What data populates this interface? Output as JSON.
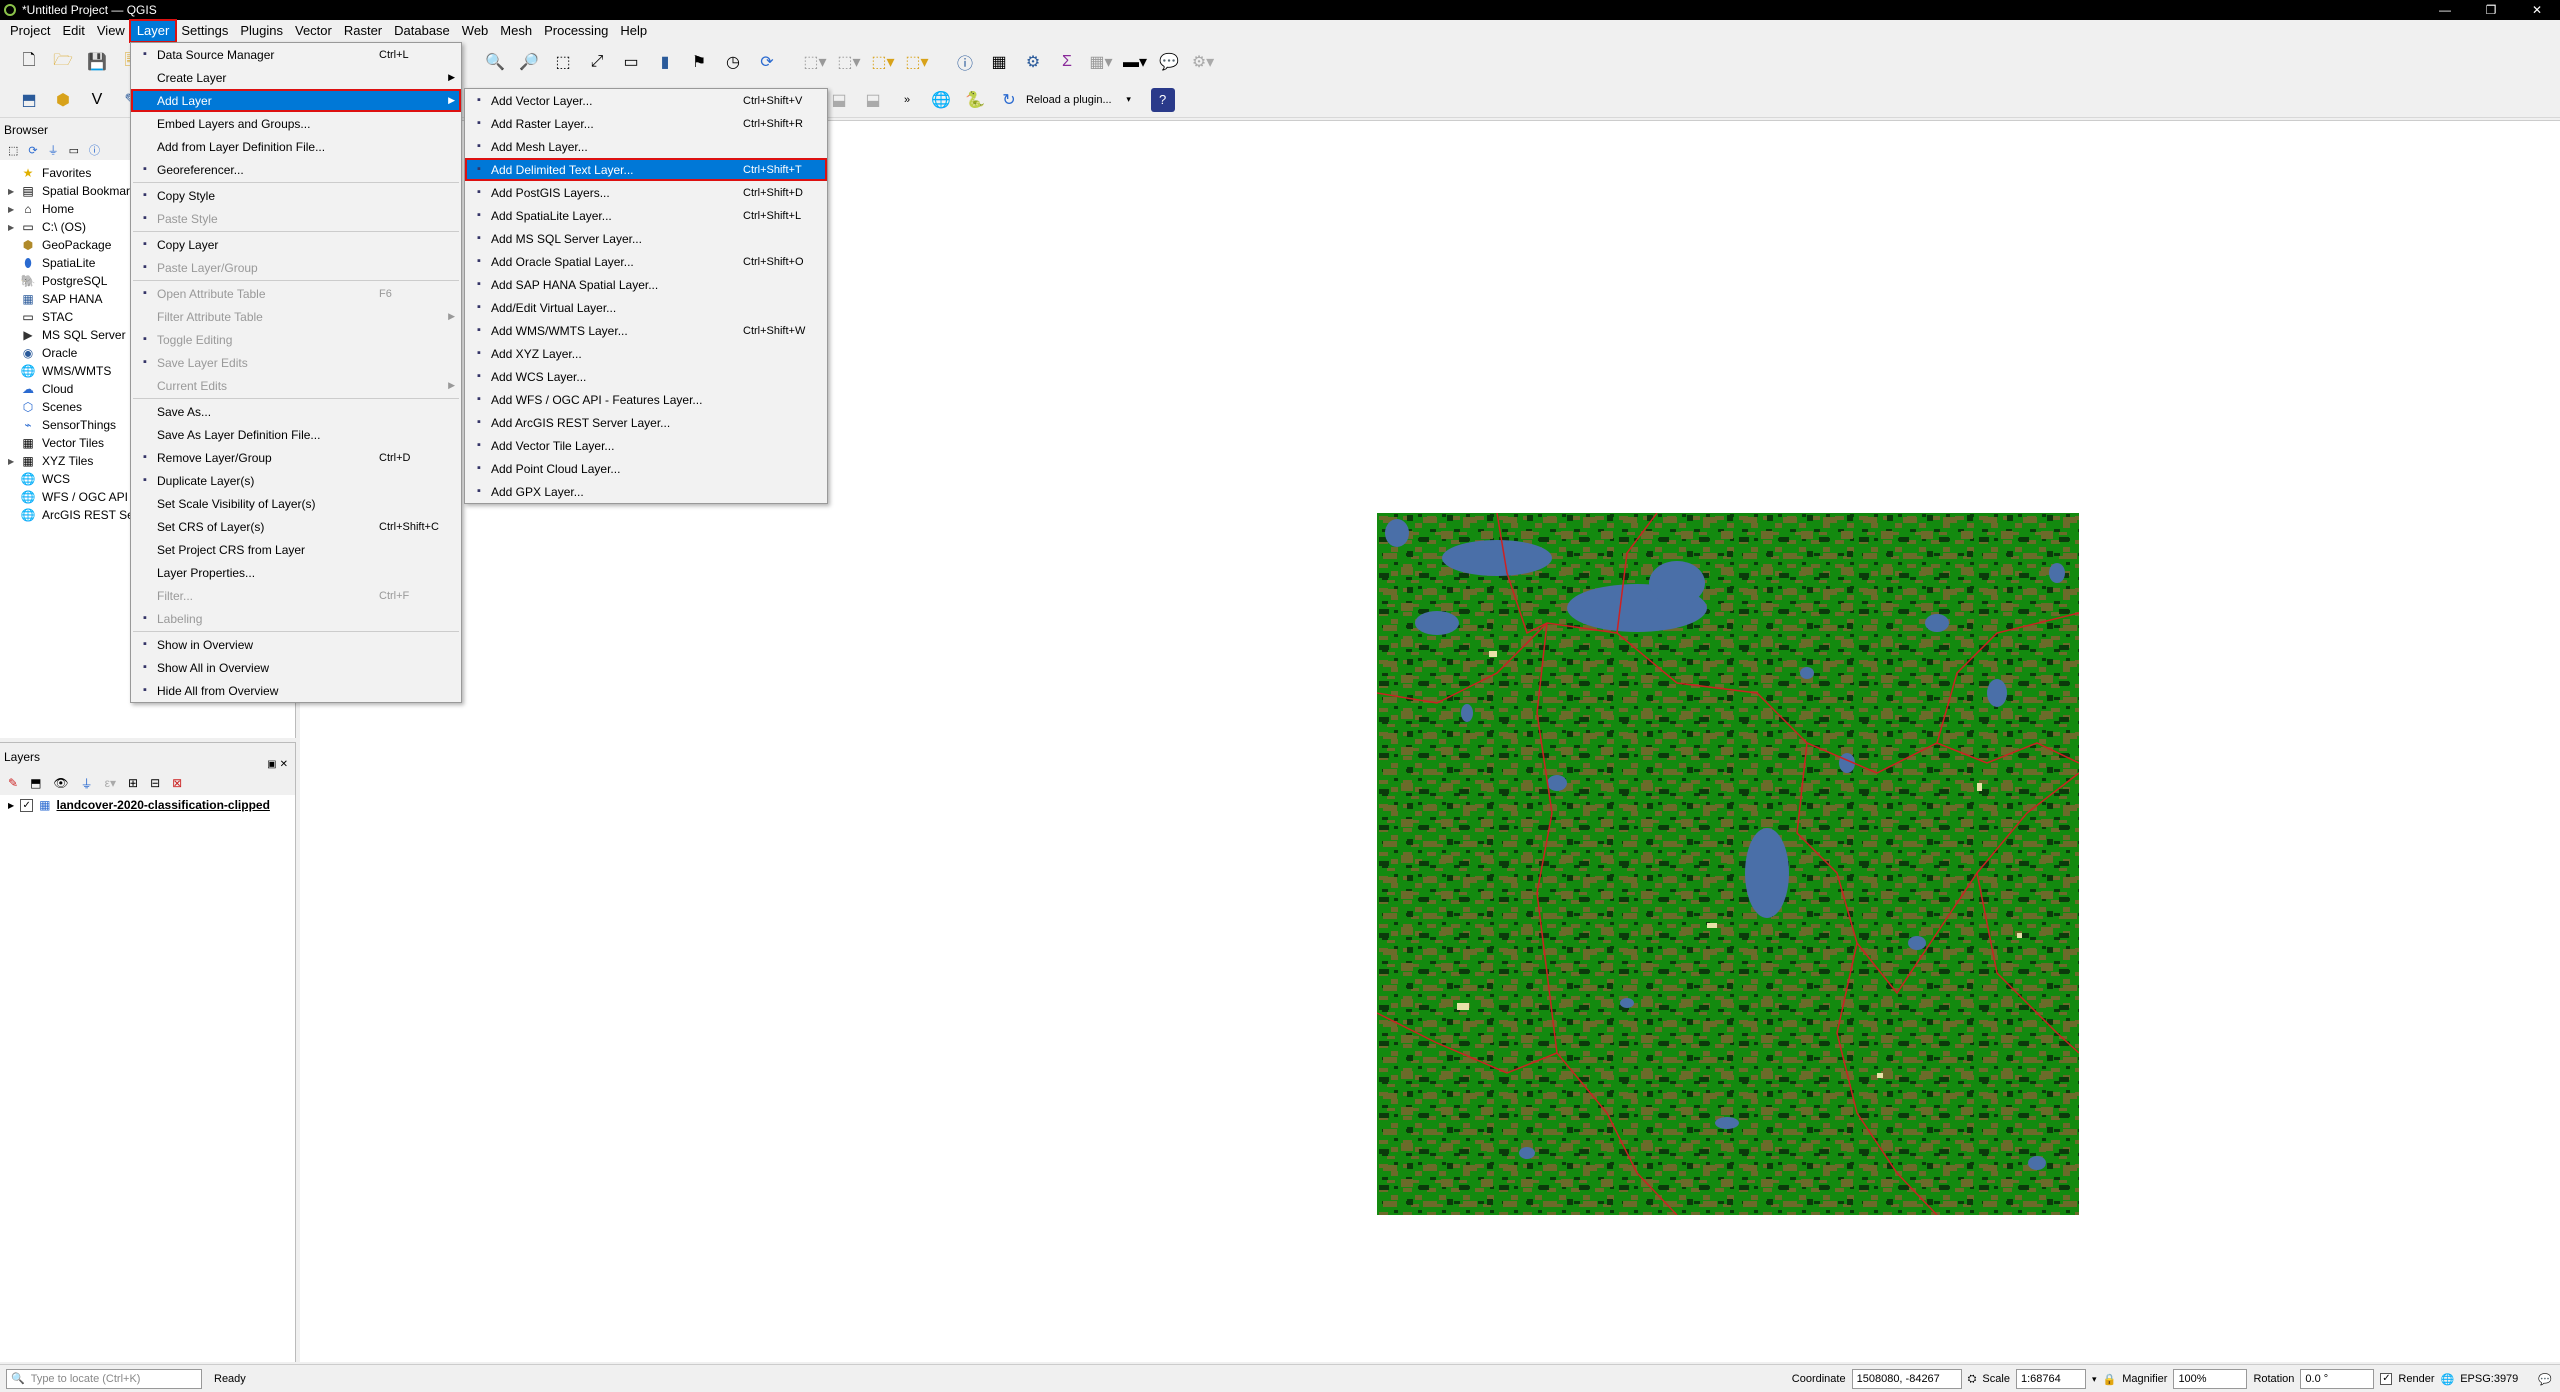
{
  "window": {
    "title": "*Untitled Project — QGIS",
    "controls": [
      "—",
      "❐",
      "✕"
    ]
  },
  "menubar": [
    "Project",
    "Edit",
    "View",
    "Layer",
    "Settings",
    "Plugins",
    "Vector",
    "Raster",
    "Database",
    "Web",
    "Mesh",
    "Processing",
    "Help"
  ],
  "toolbar2": {
    "reload_plugin": "Reload a plugin..."
  },
  "browser": {
    "title": "Browser",
    "items": [
      {
        "label": "Favorites",
        "icon": "star-icon",
        "expand": false
      },
      {
        "label": "Spatial Bookmarks",
        "icon": "bookmark-icon",
        "expand": true
      },
      {
        "label": "Home",
        "icon": "home-icon",
        "expand": true
      },
      {
        "label": "C:\\ (OS)",
        "icon": "drive-icon",
        "expand": true
      },
      {
        "label": "GeoPackage",
        "icon": "geopackage-icon",
        "expand": false
      },
      {
        "label": "SpatiaLite",
        "icon": "spatialite-icon",
        "expand": false
      },
      {
        "label": "PostgreSQL",
        "icon": "postgresql-icon",
        "expand": false
      },
      {
        "label": "SAP HANA",
        "icon": "sap-hana-icon",
        "expand": false
      },
      {
        "label": "STAC",
        "icon": "stac-icon",
        "expand": false
      },
      {
        "label": "MS SQL Server",
        "icon": "mssql-icon",
        "expand": false
      },
      {
        "label": "Oracle",
        "icon": "oracle-icon",
        "expand": false
      },
      {
        "label": "WMS/WMTS",
        "icon": "wms-icon",
        "expand": false
      },
      {
        "label": "Cloud",
        "icon": "cloud-icon",
        "expand": false
      },
      {
        "label": "Scenes",
        "icon": "scenes-icon",
        "expand": false
      },
      {
        "label": "SensorThings",
        "icon": "sensorthings-icon",
        "expand": false
      },
      {
        "label": "Vector Tiles",
        "icon": "vector-tiles-icon",
        "expand": false
      },
      {
        "label": "XYZ Tiles",
        "icon": "xyz-tiles-icon",
        "expand": true
      },
      {
        "label": "WCS",
        "icon": "wcs-icon",
        "expand": false
      },
      {
        "label": "WFS / OGC API - Features",
        "icon": "wfs-icon",
        "expand": false
      },
      {
        "label": "ArcGIS REST Servers",
        "icon": "arcgis-icon",
        "expand": false
      }
    ]
  },
  "layers": {
    "title": "Layers",
    "items": [
      {
        "label": "landcover-2020-classification-clipped",
        "checked": true
      }
    ]
  },
  "layer_menu": [
    {
      "label": "Data Source Manager",
      "shortcut": "Ctrl+L",
      "icon": "data-source-manager-icon"
    },
    {
      "label": "Create Layer",
      "submenu": true
    },
    {
      "label": "Add Layer",
      "submenu": true,
      "highlighted": true
    },
    {
      "label": "Embed Layers and Groups..."
    },
    {
      "label": "Add from Layer Definition File..."
    },
    {
      "label": "Georeferencer...",
      "icon": "georeferencer-icon"
    },
    {
      "sep": true
    },
    {
      "label": "Copy Style",
      "icon": "copy-style-icon"
    },
    {
      "label": "Paste Style",
      "icon": "paste-style-icon",
      "disabled": true
    },
    {
      "sep": true
    },
    {
      "label": "Copy Layer",
      "icon": "copy-layer-icon"
    },
    {
      "label": "Paste Layer/Group",
      "icon": "paste-layer-icon",
      "disabled": true
    },
    {
      "sep": true
    },
    {
      "label": "Open Attribute Table",
      "shortcut": "F6",
      "icon": "attribute-table-icon",
      "disabled": true
    },
    {
      "label": "Filter Attribute Table",
      "submenu": true,
      "disabled": true
    },
    {
      "label": "Toggle Editing",
      "icon": "pencil-icon",
      "disabled": true
    },
    {
      "label": "Save Layer Edits",
      "icon": "save-edits-icon",
      "disabled": true
    },
    {
      "label": "Current Edits",
      "submenu": true,
      "disabled": true
    },
    {
      "sep": true
    },
    {
      "label": "Save As..."
    },
    {
      "label": "Save As Layer Definition File..."
    },
    {
      "label": "Remove Layer/Group",
      "shortcut": "Ctrl+D",
      "icon": "remove-layer-icon"
    },
    {
      "label": "Duplicate Layer(s)",
      "icon": "duplicate-layer-icon"
    },
    {
      "label": "Set Scale Visibility of Layer(s)"
    },
    {
      "label": "Set CRS of Layer(s)",
      "shortcut": "Ctrl+Shift+C"
    },
    {
      "label": "Set Project CRS from Layer"
    },
    {
      "label": "Layer Properties..."
    },
    {
      "label": "Filter...",
      "shortcut": "Ctrl+F",
      "disabled": true
    },
    {
      "label": "Labeling",
      "icon": "labeling-icon",
      "disabled": true
    },
    {
      "sep": true
    },
    {
      "label": "Show in Overview",
      "icon": "overview-icon"
    },
    {
      "label": "Show All in Overview",
      "icon": "overview-icon"
    },
    {
      "label": "Hide All from Overview",
      "icon": "overview-icon"
    }
  ],
  "add_layer_menu": [
    {
      "label": "Add Vector Layer...",
      "shortcut": "Ctrl+Shift+V",
      "icon": "vector-layer-icon"
    },
    {
      "label": "Add Raster Layer...",
      "shortcut": "Ctrl+Shift+R",
      "icon": "raster-layer-icon"
    },
    {
      "label": "Add Mesh Layer...",
      "icon": "mesh-layer-icon"
    },
    {
      "label": "Add Delimited Text Layer...",
      "shortcut": "Ctrl+Shift+T",
      "icon": "delimited-text-icon",
      "highlighted": true
    },
    {
      "label": "Add PostGIS Layers...",
      "shortcut": "Ctrl+Shift+D",
      "icon": "postgis-icon"
    },
    {
      "label": "Add SpatiaLite Layer...",
      "shortcut": "Ctrl+Shift+L",
      "icon": "spatialite-icon"
    },
    {
      "label": "Add MS SQL Server Layer...",
      "icon": "mssql-icon"
    },
    {
      "label": "Add Oracle Spatial Layer...",
      "shortcut": "Ctrl+Shift+O",
      "icon": "oracle-icon"
    },
    {
      "label": "Add SAP HANA Spatial Layer...",
      "icon": "sap-hana-icon"
    },
    {
      "label": "Add/Edit Virtual Layer...",
      "icon": "virtual-layer-icon"
    },
    {
      "label": "Add WMS/WMTS Layer...",
      "shortcut": "Ctrl+Shift+W",
      "icon": "wms-icon"
    },
    {
      "label": "Add XYZ Layer...",
      "icon": "xyz-icon"
    },
    {
      "label": "Add WCS Layer...",
      "icon": "wcs-icon"
    },
    {
      "label": "Add WFS / OGC API - Features Layer...",
      "icon": "wfs-icon"
    },
    {
      "label": "Add ArcGIS REST Server Layer...",
      "icon": "arcgis-icon"
    },
    {
      "label": "Add Vector Tile Layer...",
      "icon": "vector-tile-icon"
    },
    {
      "label": "Add Point Cloud Layer...",
      "icon": "point-cloud-icon"
    },
    {
      "label": "Add GPX Layer...",
      "icon": "gpx-icon"
    }
  ],
  "statusbar": {
    "locator_placeholder": "Type to locate (Ctrl+K)",
    "ready": "Ready",
    "coordinate_label": "Coordinate",
    "coordinate_value": "1508080, -84267",
    "scale_label": "Scale",
    "scale_value": "1:68764",
    "magnifier_label": "Magnifier",
    "magnifier_value": "100%",
    "rotation_label": "Rotation",
    "rotation_value": "0.0 °",
    "render_label": "Render",
    "crs": "EPSG:3979"
  },
  "colors": {
    "accent": "#0078d7",
    "highlight_outline": "#dd1111",
    "forest": "#138a0f",
    "shrub": "#6b6b2a",
    "water": "#4a6fa8",
    "dark_forest": "#0b3a0b",
    "boundary": "#cc2222"
  }
}
